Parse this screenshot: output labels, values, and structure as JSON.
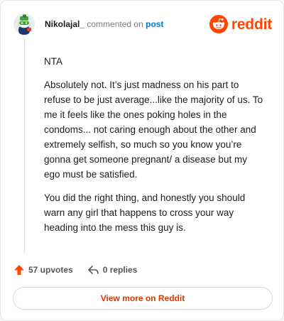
{
  "header": {
    "username": "Nikolajal_",
    "commented_on": "commented on",
    "post_link": "post",
    "brand_wordmark": "reddit"
  },
  "comment": {
    "paragraphs": [
      "NTA",
      "Absolutely not. It’s just madness on his part to refuse to be just average...like the majority of us. To me it feels like the ones poking holes in the condoms... not caring enough about the other and extremely selfish, so much so you know you’re gonna get someone pregnant/ a disease but my ego must be satisfied.",
      "You did the right thing, and honestly you should warn any girl that happens to cross your way heading into the mess this guy is."
    ]
  },
  "actions": {
    "upvotes": "57 upvotes",
    "replies": "0 replies"
  },
  "footer": {
    "view_more": "View more on Reddit"
  },
  "colors": {
    "brand": "#ff4500",
    "link": "#0079d3",
    "view_more": "#d93a00",
    "upvote": "#ff4500"
  },
  "icons": [
    "avatar",
    "reddit-logo-icon",
    "upvote-arrow-icon",
    "reply-icon"
  ]
}
